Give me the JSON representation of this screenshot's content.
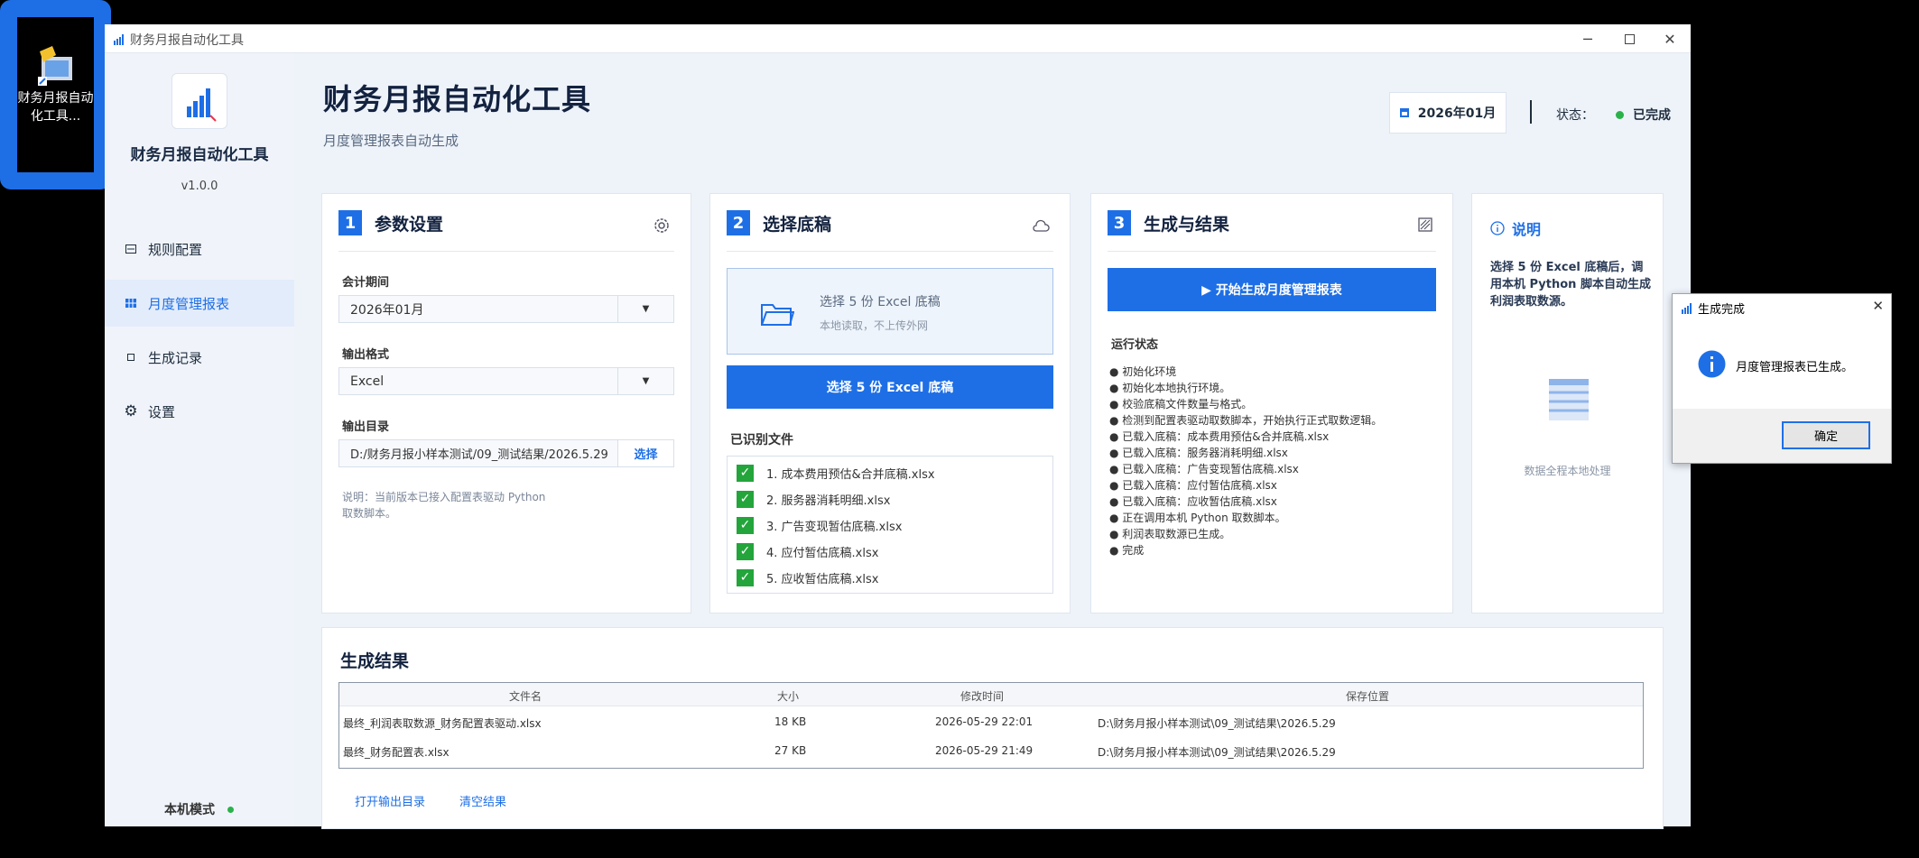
{
  "desktop": {
    "icon_label": "财务月报自动化工具..."
  },
  "window": {
    "title": "财务月报自动化工具"
  },
  "sidebar": {
    "app_name": "财务月报自动化工具",
    "version": "v1.0.0",
    "items": [
      {
        "label": "规则配置",
        "icon": "doc-icon",
        "active": false
      },
      {
        "label": "月度管理报表",
        "icon": "report-icon",
        "active": true
      },
      {
        "label": "生成记录",
        "icon": "record-icon",
        "active": false
      },
      {
        "label": "设置",
        "icon": "gear-icon",
        "active": false
      }
    ],
    "mode_label": "本机模式"
  },
  "header": {
    "title": "财务月报自动化工具",
    "subtitle": "月度管理报表自动生成",
    "period": "2026年01月",
    "status_label": "状态：",
    "status_value": "已完成"
  },
  "params": {
    "step": "1",
    "title": "参数设置",
    "period_label": "会计期间",
    "period_value": "2026年01月",
    "format_label": "输出格式",
    "format_value": "Excel",
    "dir_label": "输出目录",
    "dir_value": "D:/财务月报小样本测试/09_测试结果/2026.5.29",
    "dir_button": "选择",
    "note": "说明：当前版本已接入配置表驱动 Python 取数脚本。"
  },
  "select": {
    "step": "2",
    "title": "选择底稿",
    "drop_title": "选择 5 份 Excel 底稿",
    "drop_sub": "本地读取，不上传外网",
    "button": "选择 5 份 Excel 底稿",
    "files_label": "已识别文件",
    "files": [
      "1. 成本费用预估&合并底稿.xlsx",
      "2. 服务器消耗明细.xlsx",
      "3. 广告变现暂估底稿.xlsx",
      "4. 应付暂估底稿.xlsx",
      "5. 应收暂估底稿.xlsx"
    ]
  },
  "generate": {
    "step": "3",
    "title": "生成与结果",
    "button": "▶  开始生成月度管理报表",
    "log_label": "运行状态",
    "log": [
      "● 初始化环境",
      "● 初始化本地执行环境。",
      "● 校验底稿文件数量与格式。",
      "● 检测到配置表驱动取数脚本，开始执行正式取数逻辑。",
      "● 已载入底稿：成本费用预估&合并底稿.xlsx",
      "● 已载入底稿：服务器消耗明细.xlsx",
      "● 已载入底稿：广告变现暂估底稿.xlsx",
      "● 已载入底稿：应付暂估底稿.xlsx",
      "● 已载入底稿：应收暂估底稿.xlsx",
      "● 正在调用本机 Python 取数脚本。",
      "● 利润表取数源已生成。",
      "● 完成"
    ]
  },
  "info": {
    "title": "说明",
    "text": "选择 5 份 Excel 底稿后，调用本机 Python 脚本自动生成利润表取数源。",
    "footer": "数据全程本地处理"
  },
  "results": {
    "title": "生成结果",
    "columns": [
      "文件名",
      "大小",
      "修改时间",
      "保存位置"
    ],
    "rows": [
      [
        "最终_利润表取数源_财务配置表驱动.xlsx",
        "18 KB",
        "2026-05-29 22:01",
        "D:\\财务月报小样本测试\\09_测试结果\\2026.5.29"
      ],
      [
        "最终_财务配置表.xlsx",
        "27 KB",
        "2026-05-29 21:49",
        "D:\\财务月报小样本测试\\09_测试结果\\2026.5.29"
      ]
    ],
    "open_dir": "打开输出目录",
    "clear": "清空结果"
  },
  "dialog": {
    "title": "生成完成",
    "message": "月度管理报表已生成。",
    "ok": "确定"
  },
  "colors": {
    "accent": "#1e6fe6",
    "success": "#23a53b",
    "background": "#eef3fa"
  }
}
